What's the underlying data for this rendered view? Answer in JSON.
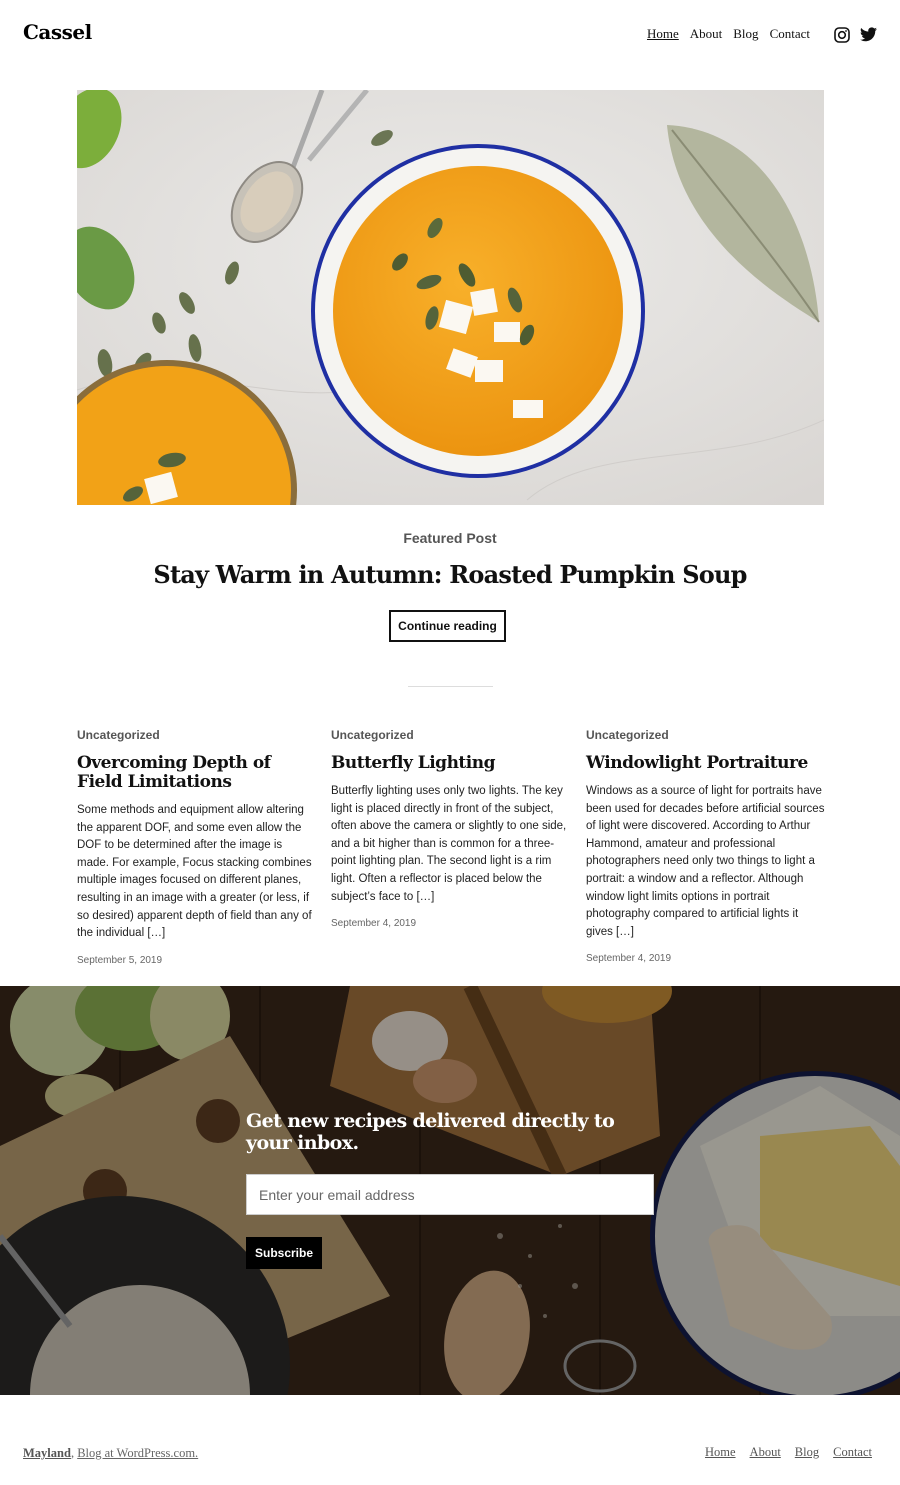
{
  "site": {
    "title": "Cassel"
  },
  "nav": {
    "items": [
      "Home",
      "About",
      "Blog",
      "Contact"
    ]
  },
  "social": {
    "icons": [
      "instagram-icon",
      "twitter-icon"
    ]
  },
  "featured": {
    "label": "Featured Post",
    "title": "Stay Warm in Autumn: Roasted Pumpkin Soup",
    "button": "Continue reading"
  },
  "posts": [
    {
      "category": "Uncategorized",
      "title": "Overcoming Depth of Field Limitations",
      "excerpt": "Some methods and equipment allow altering the apparent DOF, and some even allow the DOF to be determined after the image is made. For example, Focus stacking combines multiple images focused on different planes, resulting in an image with a greater (or less, if so desired) apparent depth of field than any of the individual […]",
      "date": "September 5, 2019"
    },
    {
      "category": "Uncategorized",
      "title": "Butterfly Lighting",
      "excerpt": "Butterfly lighting uses only two lights. The key light is placed directly in front of the subject, often above the camera or slightly to one side, and a bit higher than is common for a three-point lighting plan. The second light is a rim light. Often a reflector is placed below the subject’s face to […]",
      "date": "September 4, 2019"
    },
    {
      "category": "Uncategorized",
      "title": "Windowlight Portraiture",
      "excerpt": "Windows as a source of light for portraits have been used for decades before artificial sources of light were discovered. According to Arthur Hammond, amateur and professional photographers need only two things to light a portrait: a window and a reflector. Although window light limits options in portrait photography compared to artificial lights it gives […]",
      "date": "September 4, 2019"
    }
  ],
  "subscribe": {
    "heading": "Get new recipes delivered directly to your inbox.",
    "placeholder": "Enter your email address",
    "button": "Subscribe"
  },
  "footer": {
    "site_link": "Mayland",
    "separator": ",",
    "credit_link": "Blog at WordPress.com.",
    "nav": [
      "Home",
      "About",
      "Blog",
      "Contact"
    ]
  },
  "colors": {
    "soup": "#f4a019",
    "bowl_rim": "#1f2fa3",
    "board": "#8a5a2e",
    "band_bg": "#3a271a"
  }
}
